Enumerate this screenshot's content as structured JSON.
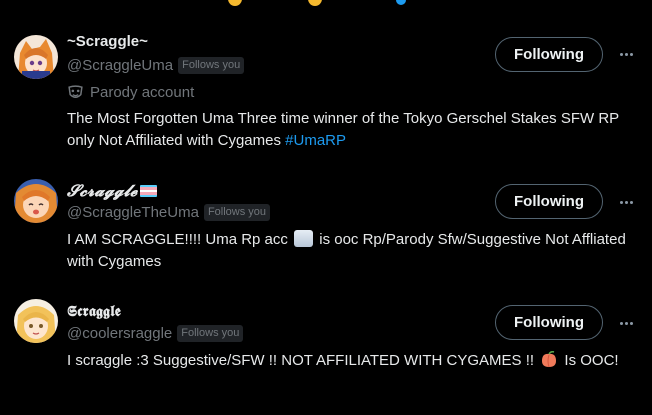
{
  "cards": [
    {
      "display_name": "~Scraggle~",
      "handle": "@ScraggleUma",
      "follows_you": "Follows you",
      "button": "Following",
      "parody_label": "Parody account",
      "bio_text": "The Most Forgotten Uma Three time winner of the Tokyo Gerschel Stakes SFW RP only Not Affiliated with Cygames ",
      "bio_hashtag": "#UmaRP"
    },
    {
      "display_name": "𝓢𝓬𝓻𝓪𝓰𝓰𝓵𝓮",
      "handle": "@ScraggleTheUma",
      "follows_you": "Follows you",
      "button": "Following",
      "bio_part1": "I AM SCRAGGLE!!!! Uma Rp acc ",
      "bio_part2": " is ooc Rp/Parody Sfw/Suggestive Not Affliated with Cygames",
      "emoji": "cloud-emoji"
    },
    {
      "display_name": "𝕾𝖈𝖗𝖆𝖌𝖌𝖑𝖊",
      "handle": "@coolersraggle",
      "follows_you": "Follows you",
      "button": "Following",
      "bio_part1": "I scraggle :3 Suggestive/SFW !! NOT AFFILIATED WITH CYGAMES !! ",
      "bio_part2": " Is OOC!",
      "emoji": "peach-emoji"
    }
  ],
  "colors": {
    "background": "#000000",
    "text": "#e7e9ea",
    "secondary": "#71767b",
    "link": "#1d9bf0",
    "button_border": "#536471"
  }
}
